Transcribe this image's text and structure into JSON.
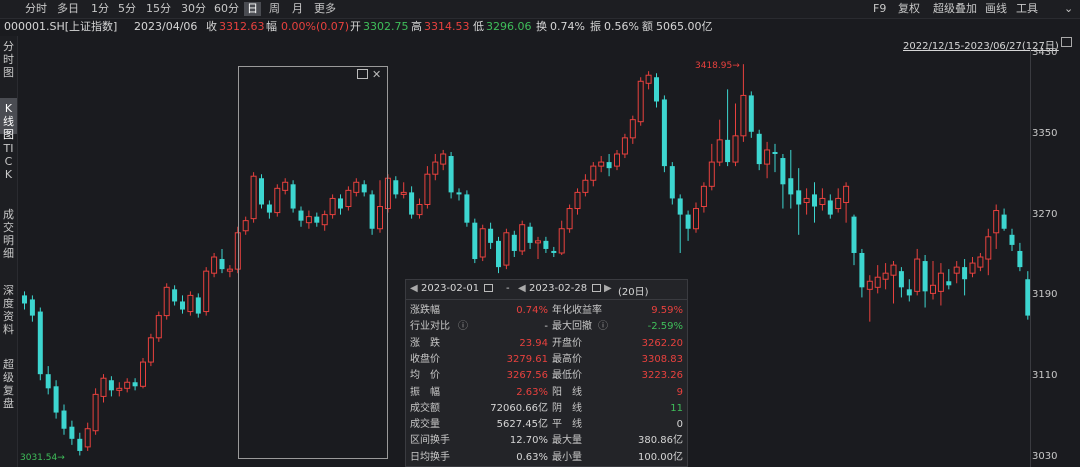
{
  "toolbar": {
    "timeframes": [
      "分时",
      "多日",
      "1分",
      "5分",
      "15分",
      "30分",
      "60分",
      "日",
      "周",
      "月",
      "更多"
    ],
    "active": "日",
    "right": [
      "F9",
      "复权",
      "超级叠加",
      "画线",
      "工具"
    ]
  },
  "quote": {
    "code": "000001.SH[上证指数]",
    "date": "2023/04/06",
    "close_label": "收",
    "close": "3312.63",
    "change_label": "幅",
    "change": "0.00%(0.07)",
    "open_label": "开",
    "open": "3302.75",
    "high_label": "高",
    "high": "3314.53",
    "low_label": "低",
    "low": "3296.06",
    "turnover_label": "换",
    "turnover": "0.74%",
    "amplitude_label": "振",
    "amplitude": "0.56%",
    "amount_label": "额",
    "amount": "5065.00亿"
  },
  "sidebar": [
    "分时图",
    "K线图",
    "TICK",
    "成交明细",
    "深度资料",
    "超级复盘"
  ],
  "sidebar_active": "K线图",
  "date_range": "2022/12/15-2023/06/27(127日)",
  "y_axis": [
    "3430",
    "3350",
    "3270",
    "3190",
    "3110",
    "3030"
  ],
  "high_mark": "3418.95",
  "low_mark": "3031.54",
  "panel": {
    "start": "2023-02-01",
    "sep": "-",
    "end": "2023-02-28",
    "days": "(20日)",
    "rows": [
      {
        "l": "涨跌幅",
        "v1": "0.74%",
        "c1": "red",
        "l2": "年化收益率",
        "v2": "9.59%",
        "c2": "red"
      },
      {
        "l": "行业对比",
        "v1": "-",
        "c1": "white",
        "l2": "最大回撤",
        "v2": "-2.59%",
        "c2": "green"
      },
      {
        "l": "涨　跌",
        "v1": "23.94",
        "c1": "red",
        "l2": "开盘价",
        "v2": "3262.20",
        "c2": "red"
      },
      {
        "l": "收盘价",
        "v1": "3279.61",
        "c1": "red",
        "l2": "最高价",
        "v2": "3308.83",
        "c2": "red"
      },
      {
        "l": "均　价",
        "v1": "3267.56",
        "c1": "red",
        "l2": "最低价",
        "v2": "3223.26",
        "c2": "red"
      },
      {
        "l": "振　幅",
        "v1": "2.63%",
        "c1": "red",
        "l2": "阳　线",
        "v2": "9",
        "c2": "red"
      },
      {
        "l": "成交额",
        "v1": "72060.66亿",
        "c1": "white",
        "l2": "阴　线",
        "v2": "11",
        "c2": "green"
      },
      {
        "l": "成交量",
        "v1": "5627.45亿",
        "c1": "white",
        "l2": "平　线",
        "v2": "0",
        "c2": "white"
      },
      {
        "l": "区间换手",
        "v1": "12.70%",
        "c1": "white",
        "l2": "最大量",
        "v2": "380.86亿",
        "c2": "white"
      },
      {
        "l": "日均换手",
        "v1": "0.63%",
        "c1": "white",
        "l2": "最小量",
        "v2": "100.00亿",
        "c2": "white"
      }
    ]
  },
  "colors": {
    "up": "#e8413e",
    "down": "#3dd6d0",
    "bg": "#1a1b1f"
  },
  "chart_data": {
    "type": "candlestick",
    "ylim": [
      3030,
      3430
    ],
    "candles": [
      [
        3190,
        3182,
        3194,
        3176
      ],
      [
        3186,
        3170,
        3190,
        3164
      ],
      [
        3174,
        3112,
        3178,
        3106
      ],
      [
        3112,
        3098,
        3120,
        3092
      ],
      [
        3100,
        3074,
        3106,
        3068
      ],
      [
        3076,
        3058,
        3082,
        3052
      ],
      [
        3060,
        3048,
        3066,
        3042
      ],
      [
        3048,
        3036,
        3054,
        3031.54
      ],
      [
        3040,
        3058,
        3064,
        3036
      ],
      [
        3056,
        3092,
        3098,
        3052
      ],
      [
        3090,
        3108,
        3112,
        3084
      ],
      [
        3106,
        3096,
        3110,
        3090
      ],
      [
        3096,
        3098,
        3104,
        3090
      ],
      [
        3098,
        3104,
        3108,
        3094
      ],
      [
        3104,
        3100,
        3108,
        3096
      ],
      [
        3100,
        3124,
        3128,
        3098
      ],
      [
        3124,
        3148,
        3152,
        3120
      ],
      [
        3148,
        3170,
        3174,
        3144
      ],
      [
        3170,
        3198,
        3202,
        3166
      ],
      [
        3196,
        3184,
        3200,
        3180
      ],
      [
        3184,
        3176,
        3190,
        3172
      ],
      [
        3174,
        3190,
        3194,
        3170
      ],
      [
        3188,
        3172,
        3192,
        3168
      ],
      [
        3174,
        3214,
        3218,
        3170
      ],
      [
        3212,
        3228,
        3232,
        3208
      ],
      [
        3226,
        3216,
        3236,
        3212
      ],
      [
        3214,
        3216,
        3220,
        3208
      ],
      [
        3216,
        3252,
        3258,
        3212
      ],
      [
        3254,
        3264,
        3268,
        3250
      ],
      [
        3266,
        3308,
        3312,
        3262
      ],
      [
        3306,
        3280,
        3310,
        3276
      ],
      [
        3280,
        3272,
        3284,
        3266
      ],
      [
        3272,
        3296,
        3300,
        3268
      ],
      [
        3294,
        3302,
        3306,
        3290
      ],
      [
        3300,
        3276,
        3304,
        3272
      ],
      [
        3274,
        3264,
        3278,
        3258
      ],
      [
        3262,
        3268,
        3274,
        3256
      ],
      [
        3268,
        3262,
        3272,
        3258
      ],
      [
        3260,
        3270,
        3274,
        3254
      ],
      [
        3270,
        3286,
        3290,
        3266
      ],
      [
        3286,
        3276,
        3290,
        3270
      ],
      [
        3278,
        3294,
        3298,
        3274
      ],
      [
        3292,
        3302,
        3306,
        3288
      ],
      [
        3300,
        3292,
        3304,
        3288
      ],
      [
        3290,
        3256,
        3294,
        3250
      ],
      [
        3256,
        3278,
        3304,
        3252
      ],
      [
        3276,
        3306,
        3310,
        3272
      ],
      [
        3304,
        3290,
        3308,
        3286
      ],
      [
        3290,
        3292,
        3302,
        3286
      ],
      [
        3292,
        3270,
        3298,
        3266
      ],
      [
        3270,
        3280,
        3286,
        3266
      ],
      [
        3280,
        3310,
        3318,
        3276
      ],
      [
        3310,
        3322,
        3330,
        3304
      ],
      [
        3320,
        3330,
        3334,
        3314
      ],
      [
        3328,
        3292,
        3332,
        3286
      ],
      [
        3292,
        3290,
        3296,
        3284
      ],
      [
        3290,
        3262,
        3294,
        3258
      ],
      [
        3262,
        3226,
        3266,
        3222
      ],
      [
        3228,
        3256,
        3260,
        3224
      ],
      [
        3256,
        3242,
        3262,
        3236
      ],
      [
        3244,
        3218,
        3248,
        3212
      ],
      [
        3220,
        3252,
        3256,
        3216
      ],
      [
        3250,
        3234,
        3254,
        3228
      ],
      [
        3234,
        3260,
        3264,
        3230
      ],
      [
        3258,
        3242,
        3262,
        3236
      ],
      [
        3242,
        3244,
        3248,
        3226
      ],
      [
        3244,
        3236,
        3248,
        3232
      ],
      [
        3234,
        3232,
        3238,
        3228
      ],
      [
        3232,
        3256,
        3264,
        3230
      ],
      [
        3256,
        3276,
        3280,
        3252
      ],
      [
        3276,
        3292,
        3296,
        3270
      ],
      [
        3292,
        3304,
        3310,
        3288
      ],
      [
        3304,
        3318,
        3322,
        3298
      ],
      [
        3318,
        3322,
        3328,
        3312
      ],
      [
        3322,
        3316,
        3330,
        3308
      ],
      [
        3318,
        3330,
        3334,
        3314
      ],
      [
        3330,
        3346,
        3350,
        3326
      ],
      [
        3346,
        3364,
        3368,
        3340
      ],
      [
        3362,
        3402,
        3406,
        3358
      ],
      [
        3400,
        3408,
        3412,
        3394
      ],
      [
        3406,
        3382,
        3410,
        3376
      ],
      [
        3384,
        3318,
        3388,
        3312
      ],
      [
        3318,
        3286,
        3322,
        3280
      ],
      [
        3286,
        3270,
        3290,
        3232
      ],
      [
        3270,
        3256,
        3274,
        3244
      ],
      [
        3256,
        3276,
        3282,
        3252
      ],
      [
        3278,
        3298,
        3302,
        3272
      ],
      [
        3298,
        3322,
        3340,
        3294
      ],
      [
        3322,
        3344,
        3364,
        3318
      ],
      [
        3344,
        3322,
        3394,
        3318
      ],
      [
        3322,
        3348,
        3380,
        3318
      ],
      [
        3348,
        3388,
        3418.95,
        3342
      ],
      [
        3388,
        3352,
        3392,
        3346
      ],
      [
        3350,
        3320,
        3354,
        3314
      ],
      [
        3320,
        3334,
        3342,
        3306
      ],
      [
        3332,
        3330,
        3340,
        3312
      ],
      [
        3326,
        3300,
        3330,
        3276
      ],
      [
        3306,
        3290,
        3334,
        3276
      ],
      [
        3294,
        3280,
        3316,
        3250
      ],
      [
        3282,
        3286,
        3296,
        3270
      ],
      [
        3290,
        3278,
        3302,
        3262
      ],
      [
        3280,
        3286,
        3296,
        3274
      ],
      [
        3284,
        3270,
        3290,
        3266
      ],
      [
        3276,
        3286,
        3296,
        3272
      ],
      [
        3282,
        3298,
        3302,
        3262
      ],
      [
        3268,
        3232,
        3270,
        3220
      ],
      [
        3232,
        3198,
        3236,
        3188
      ],
      [
        3196,
        3204,
        3210,
        3164
      ],
      [
        3198,
        3208,
        3220,
        3192
      ],
      [
        3206,
        3212,
        3222,
        3196
      ],
      [
        3210,
        3220,
        3224,
        3182
      ],
      [
        3214,
        3198,
        3218,
        3188
      ],
      [
        3196,
        3190,
        3206,
        3184
      ],
      [
        3194,
        3226,
        3236,
        3190
      ],
      [
        3224,
        3194,
        3230,
        3178
      ],
      [
        3192,
        3200,
        3224,
        3186
      ],
      [
        3194,
        3212,
        3222,
        3180
      ],
      [
        3204,
        3200,
        3216,
        3196
      ],
      [
        3212,
        3218,
        3224,
        3202
      ],
      [
        3218,
        3206,
        3226,
        3190
      ],
      [
        3212,
        3222,
        3228,
        3208
      ],
      [
        3218,
        3228,
        3232,
        3214
      ],
      [
        3226,
        3248,
        3256,
        3210
      ],
      [
        3252,
        3274,
        3280,
        3236
      ],
      [
        3270,
        3256,
        3276,
        3254
      ],
      [
        3250,
        3240,
        3256,
        3234
      ],
      [
        3234,
        3218,
        3242,
        3214
      ],
      [
        3206,
        3170,
        3214,
        3166
      ],
      [
        3162,
        3186,
        3192,
        3160
      ]
    ]
  }
}
